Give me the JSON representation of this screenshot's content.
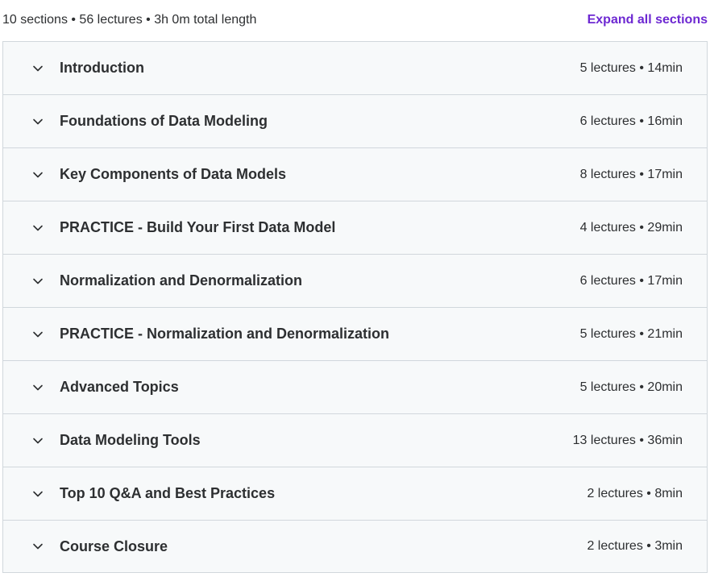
{
  "header": {
    "summary": "10 sections • 56 lectures • 3h 0m total length",
    "expand_all_label": "Expand all sections"
  },
  "sections": [
    {
      "title": "Introduction",
      "meta": "5 lectures • 14min"
    },
    {
      "title": "Foundations of Data Modeling",
      "meta": "6 lectures • 16min"
    },
    {
      "title": "Key Components of Data Models",
      "meta": "8 lectures • 17min"
    },
    {
      "title": "PRACTICE - Build Your First Data Model",
      "meta": "4 lectures • 29min"
    },
    {
      "title": "Normalization and Denormalization",
      "meta": "6 lectures • 17min"
    },
    {
      "title": "PRACTICE - Normalization and Denormalization",
      "meta": "5 lectures • 21min"
    },
    {
      "title": "Advanced Topics",
      "meta": "5 lectures • 20min"
    },
    {
      "title": "Data Modeling Tools",
      "meta": "13 lectures • 36min"
    },
    {
      "title": "Top 10 Q&A and Best Practices",
      "meta": "2 lectures • 8min"
    },
    {
      "title": "Course Closure",
      "meta": "2 lectures • 3min"
    }
  ],
  "icons": {
    "section_toggle": "chevron-down-icon"
  },
  "colors": {
    "accent": "#6d28d2",
    "text": "#2d2f31",
    "section_bg": "#f7f9fa",
    "border": "#d1d7dc"
  }
}
